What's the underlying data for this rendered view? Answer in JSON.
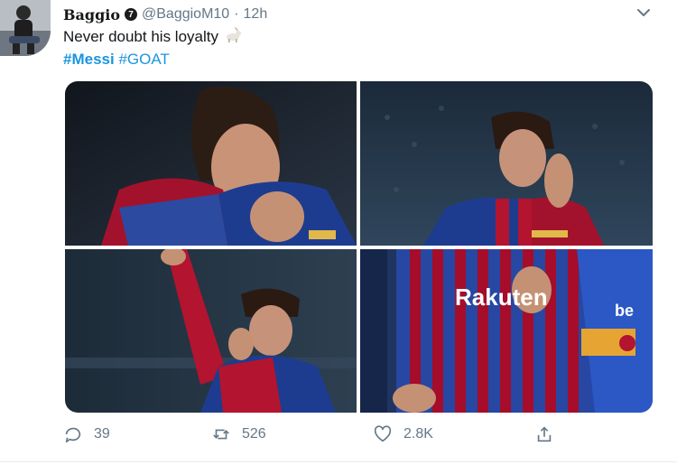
{
  "tweet": {
    "display_name": "Baggio",
    "verified_glyph": "7",
    "handle": "@BaggioM10",
    "separator": "·",
    "time": "12h",
    "text": "Never doubt his loyalty",
    "emoji": "goat-emoji",
    "hashtags": [
      "#Messi",
      "#GOAT"
    ]
  },
  "media": {
    "images": [
      {
        "name": "photo-kissing-badge-long-hair"
      },
      {
        "name": "photo-kissing-badge-stadium"
      },
      {
        "name": "photo-arm-raised-kissing-shirt"
      },
      {
        "name": "photo-rakuten-shirt-kiss",
        "shirt_text": "Rakuten",
        "sleeve_text": "be"
      }
    ]
  },
  "actions": {
    "reply_count": "39",
    "retweet_count": "526",
    "like_count": "2.8K"
  },
  "colors": {
    "link": "#1b95e0",
    "muted": "#657786",
    "barca_blue": "#1f3a8a",
    "barca_red": "#a50d2a"
  }
}
